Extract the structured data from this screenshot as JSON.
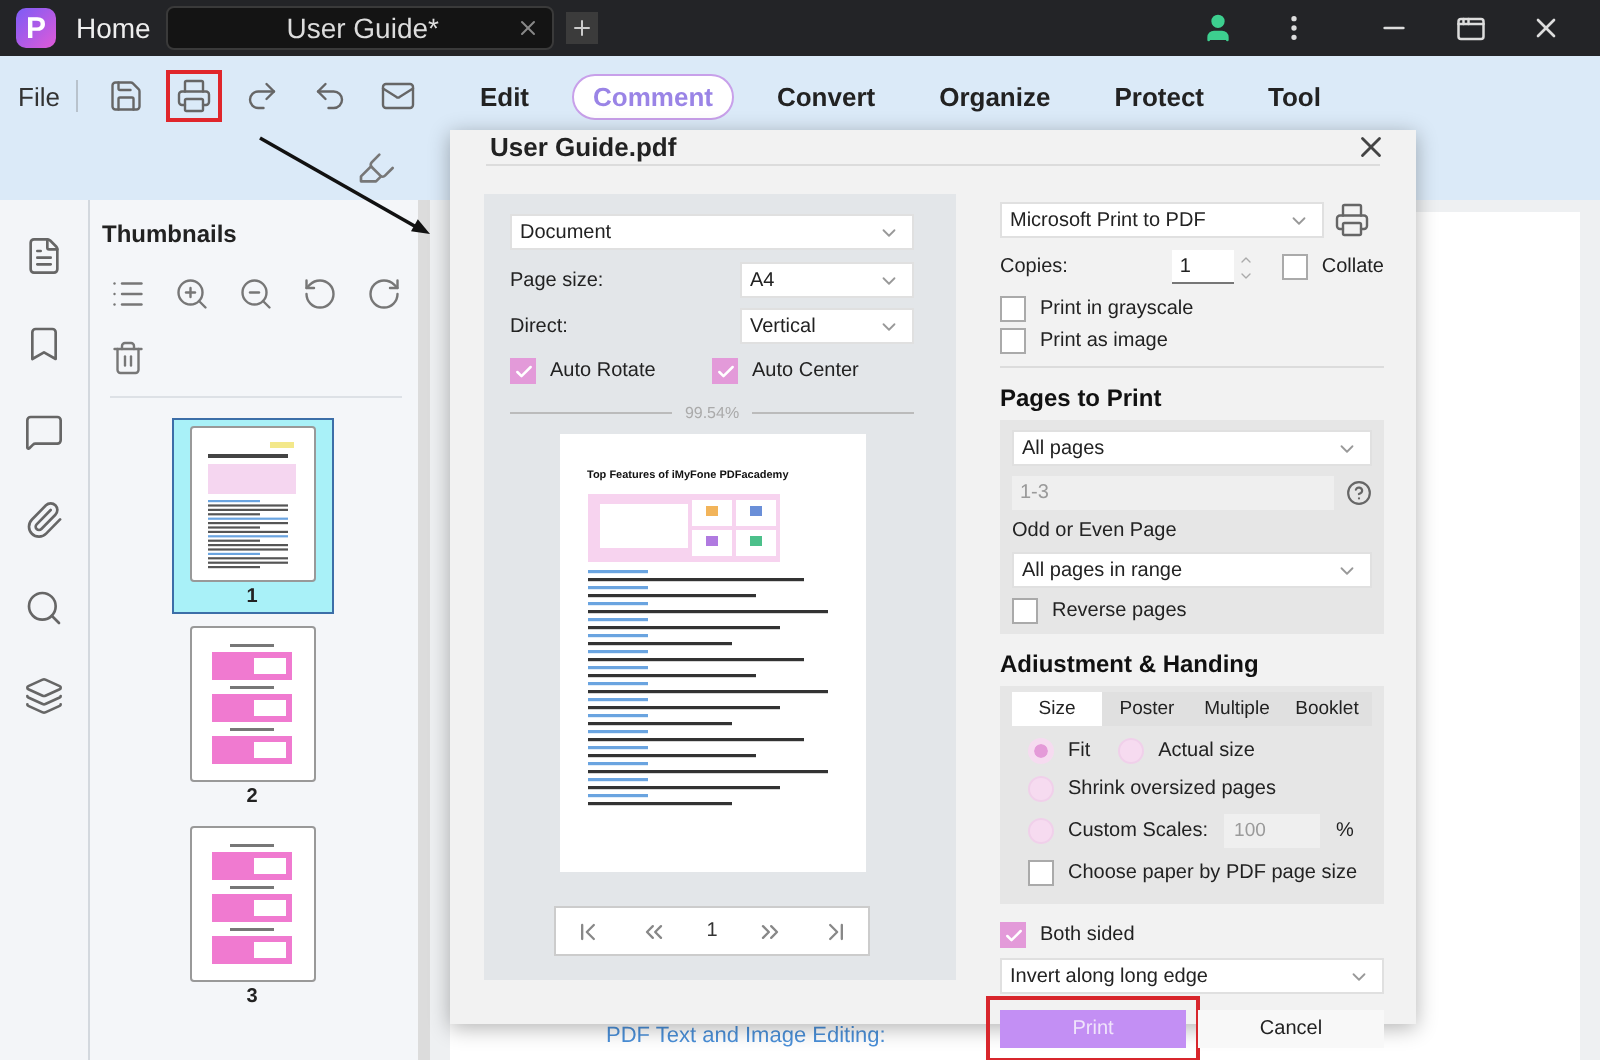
{
  "title_bar": {
    "logo": "P",
    "home": "Home",
    "tab": "User Guide*"
  },
  "toolbar": {
    "file": "File",
    "actions": [
      {
        "kind": "save",
        "highlighted": false
      },
      {
        "kind": "print",
        "highlighted": true
      },
      {
        "kind": "redo",
        "highlighted": false
      },
      {
        "kind": "undo",
        "highlighted": false
      },
      {
        "kind": "mail",
        "highlighted": false
      }
    ],
    "menus": [
      {
        "label": "Edit",
        "selected": false
      },
      {
        "label": "Comment",
        "selected": true
      },
      {
        "label": "Convert",
        "selected": false
      },
      {
        "label": "Organize",
        "selected": false
      },
      {
        "label": "Protect",
        "selected": false
      },
      {
        "label": "Tool",
        "selected": false
      }
    ]
  },
  "thumbnails": {
    "title": "Thumbnails",
    "pages": [
      {
        "label": "1",
        "kind": "text",
        "selected": true
      },
      {
        "label": "2",
        "kind": "slides",
        "selected": false
      },
      {
        "label": "3",
        "kind": "slides",
        "selected": false
      }
    ]
  },
  "document": {
    "heading": "PDF Text and Image Editing:"
  },
  "print_dialog": {
    "title": "User Guide.pdf",
    "preview": {
      "layout": "Document",
      "page_size": {
        "label": "Page size:",
        "value": "A4"
      },
      "direct": {
        "label": "Direct:",
        "value": "Vertical"
      },
      "options": [
        {
          "label": "Auto Rotate",
          "checked": true
        },
        {
          "label": "Auto Center",
          "checked": true
        }
      ],
      "zoom": "99.54%",
      "page_title": "Top Features of iMyFone PDFacademy",
      "page": "1"
    },
    "printer": "Microsoft Print to PDF",
    "copies": {
      "label": "Copies:",
      "value": "1"
    },
    "collate": {
      "label": "Collate",
      "checked": false
    },
    "print_options": [
      {
        "label": "Print in grayscale",
        "checked": false
      },
      {
        "label": "Print as image",
        "checked": false
      }
    ],
    "pages_to_print": {
      "heading": "Pages to Print",
      "range": "All pages",
      "range_field": {
        "value": "1-3",
        "disabled": true
      },
      "odd_even_label": "Odd or Even Page",
      "odd_even": "All pages in range",
      "reverse": {
        "label": "Reverse pages",
        "checked": false
      }
    },
    "adjustment": {
      "heading": "Adiustment & Handing",
      "tabs": [
        {
          "label": "Size",
          "selected": true
        },
        {
          "label": "Poster",
          "selected": false
        },
        {
          "label": "Multiple",
          "selected": false
        },
        {
          "label": "Booklet",
          "selected": false
        }
      ],
      "scale_options": [
        {
          "label": "Fit",
          "selected": true
        },
        {
          "label": "Actual size",
          "selected": false
        },
        {
          "label": "Shrink oversized pages",
          "selected": false
        },
        {
          "label": "Custom Scales:",
          "selected": false,
          "field": "100",
          "unit": "%"
        }
      ],
      "paper_by_pdf": {
        "label": "Choose paper by PDF page size",
        "checked": false
      }
    },
    "both_sided": {
      "label": "Both sided",
      "checked": true
    },
    "flip": "Invert along long edge",
    "buttons": [
      {
        "label": "Print",
        "kind": "primary",
        "highlighted": true
      },
      {
        "label": "Cancel",
        "kind": "secondary",
        "highlighted": false
      }
    ]
  }
}
